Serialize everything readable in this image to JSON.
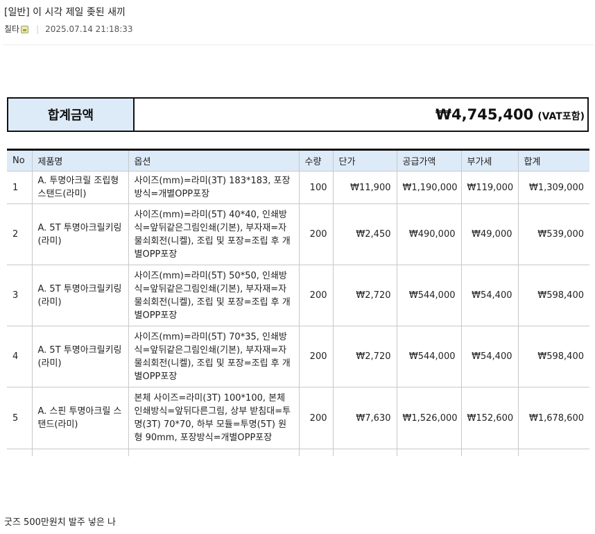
{
  "post": {
    "title": "[일반] 이 시각 제일 좆된 새끼",
    "author": "칠타",
    "author_badge_icon": "member-badge-icon",
    "date": "2025.07.14 21:18:33"
  },
  "summary": {
    "label": "합계금액",
    "amount": "₩4,745,400",
    "vat_note": "(VAT포함)"
  },
  "table": {
    "headers": [
      "No",
      "제품명",
      "옵션",
      "수량",
      "단가",
      "공급가액",
      "부가세",
      "합계"
    ],
    "rows": [
      {
        "no": "1",
        "product": "A. 투명아크릴 조립형 스탠드(라미)",
        "option": "사이즈(mm)=라미(3T) 183*183, 포장방식=개별OPP포장",
        "qty": "100",
        "unit": "₩11,900",
        "supply": "₩1,190,000",
        "vat": "₩119,000",
        "total": "₩1,309,000"
      },
      {
        "no": "2",
        "product": "A. 5T 투명아크릴키링(라미)",
        "option": "사이즈(mm)=라미(5T) 40*40, 인쇄방식=앞뒤같은그림인쇄(기본), 부자재=자물쇠회전(니켈), 조립 및 포장=조립 후 개별OPP포장",
        "qty": "200",
        "unit": "₩2,450",
        "supply": "₩490,000",
        "vat": "₩49,000",
        "total": "₩539,000"
      },
      {
        "no": "3",
        "product": "A. 5T 투명아크릴키링(라미)",
        "option": "사이즈(mm)=라미(5T) 50*50, 인쇄방식=앞뒤같은그림인쇄(기본), 부자재=자물쇠회전(니켈), 조립 및 포장=조립 후 개별OPP포장",
        "qty": "200",
        "unit": "₩2,720",
        "supply": "₩544,000",
        "vat": "₩54,400",
        "total": "₩598,400"
      },
      {
        "no": "4",
        "product": "A. 5T 투명아크릴키링(라미)",
        "option": "사이즈(mm)=라미(5T) 70*35, 인쇄방식=앞뒤같은그림인쇄(기본), 부자재=자물쇠회전(니켈), 조립 및 포장=조립 후 개별OPP포장",
        "qty": "200",
        "unit": "₩2,720",
        "supply": "₩544,000",
        "vat": "₩54,400",
        "total": "₩598,400"
      },
      {
        "no": "5",
        "product": "A. 스핀 투명아크릴 스탠드(라미)",
        "option": "본체 사이즈=라미(3T) 100*100, 본체 인쇄방식=앞뒤다른그림, 상부 받침대=투명(3T) 70*70, 하부 모듈=투명(5T) 원형 90mm, 포장방식=개별OPP포장",
        "qty": "200",
        "unit": "₩7,630",
        "supply": "₩1,526,000",
        "vat": "₩152,600",
        "total": "₩1,678,600"
      }
    ]
  },
  "caption": "굿즈 500만원치 발주 넣은 나",
  "colors": {
    "header_bg": "#ddeaf7",
    "border_dark": "#111111",
    "grid_line": "#c8c8c8"
  }
}
